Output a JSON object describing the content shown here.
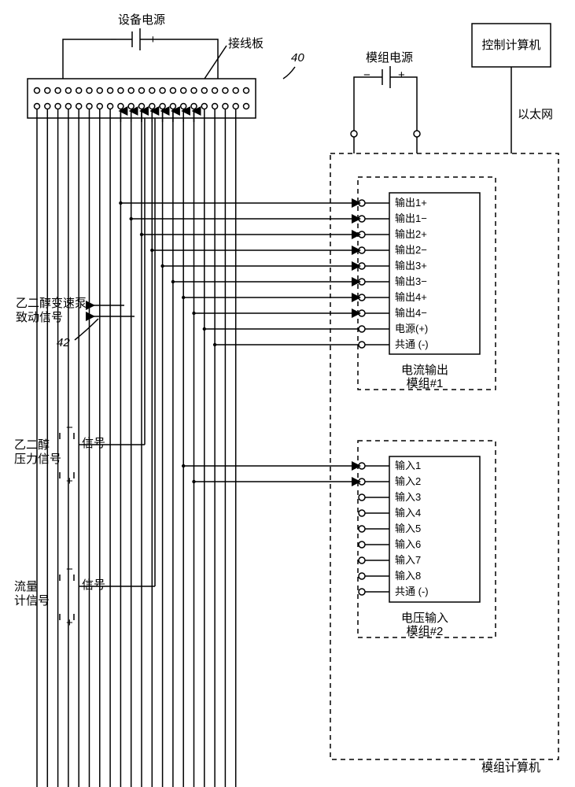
{
  "figure_ref": "40",
  "callout_ref": "42",
  "top": {
    "device_power": "设备电源",
    "terminal_board": "接线板",
    "module_power": "模组电源",
    "control_computer": "控制计算机",
    "ethernet": "以太网",
    "plus": "+",
    "minus": "−"
  },
  "left": {
    "pump_signal_l1": "乙二醇变速泵",
    "pump_signal_l2": "致动信号",
    "glycol_pressure_l1": "乙二醇",
    "glycol_pressure_l2": "压力信号",
    "signal": "信号",
    "flow_l1": "流量",
    "flow_l2": "计信号"
  },
  "module1": {
    "title_l1": "电流输出",
    "title_l2": "模组#1",
    "pins": [
      "输出1+",
      "输出1−",
      "输出2+",
      "输出2−",
      "输出3+",
      "输出3−",
      "输出4+",
      "输出4−",
      "电源(+)",
      "共通 (-)"
    ]
  },
  "module2": {
    "title_l1": "电压输入",
    "title_l2": "模组#2",
    "pins": [
      "输入1",
      "输入2",
      "输入3",
      "输入4",
      "输入5",
      "输入6",
      "输入7",
      "输入8",
      "共通 (-)"
    ]
  },
  "module_computer": "模组计算机"
}
